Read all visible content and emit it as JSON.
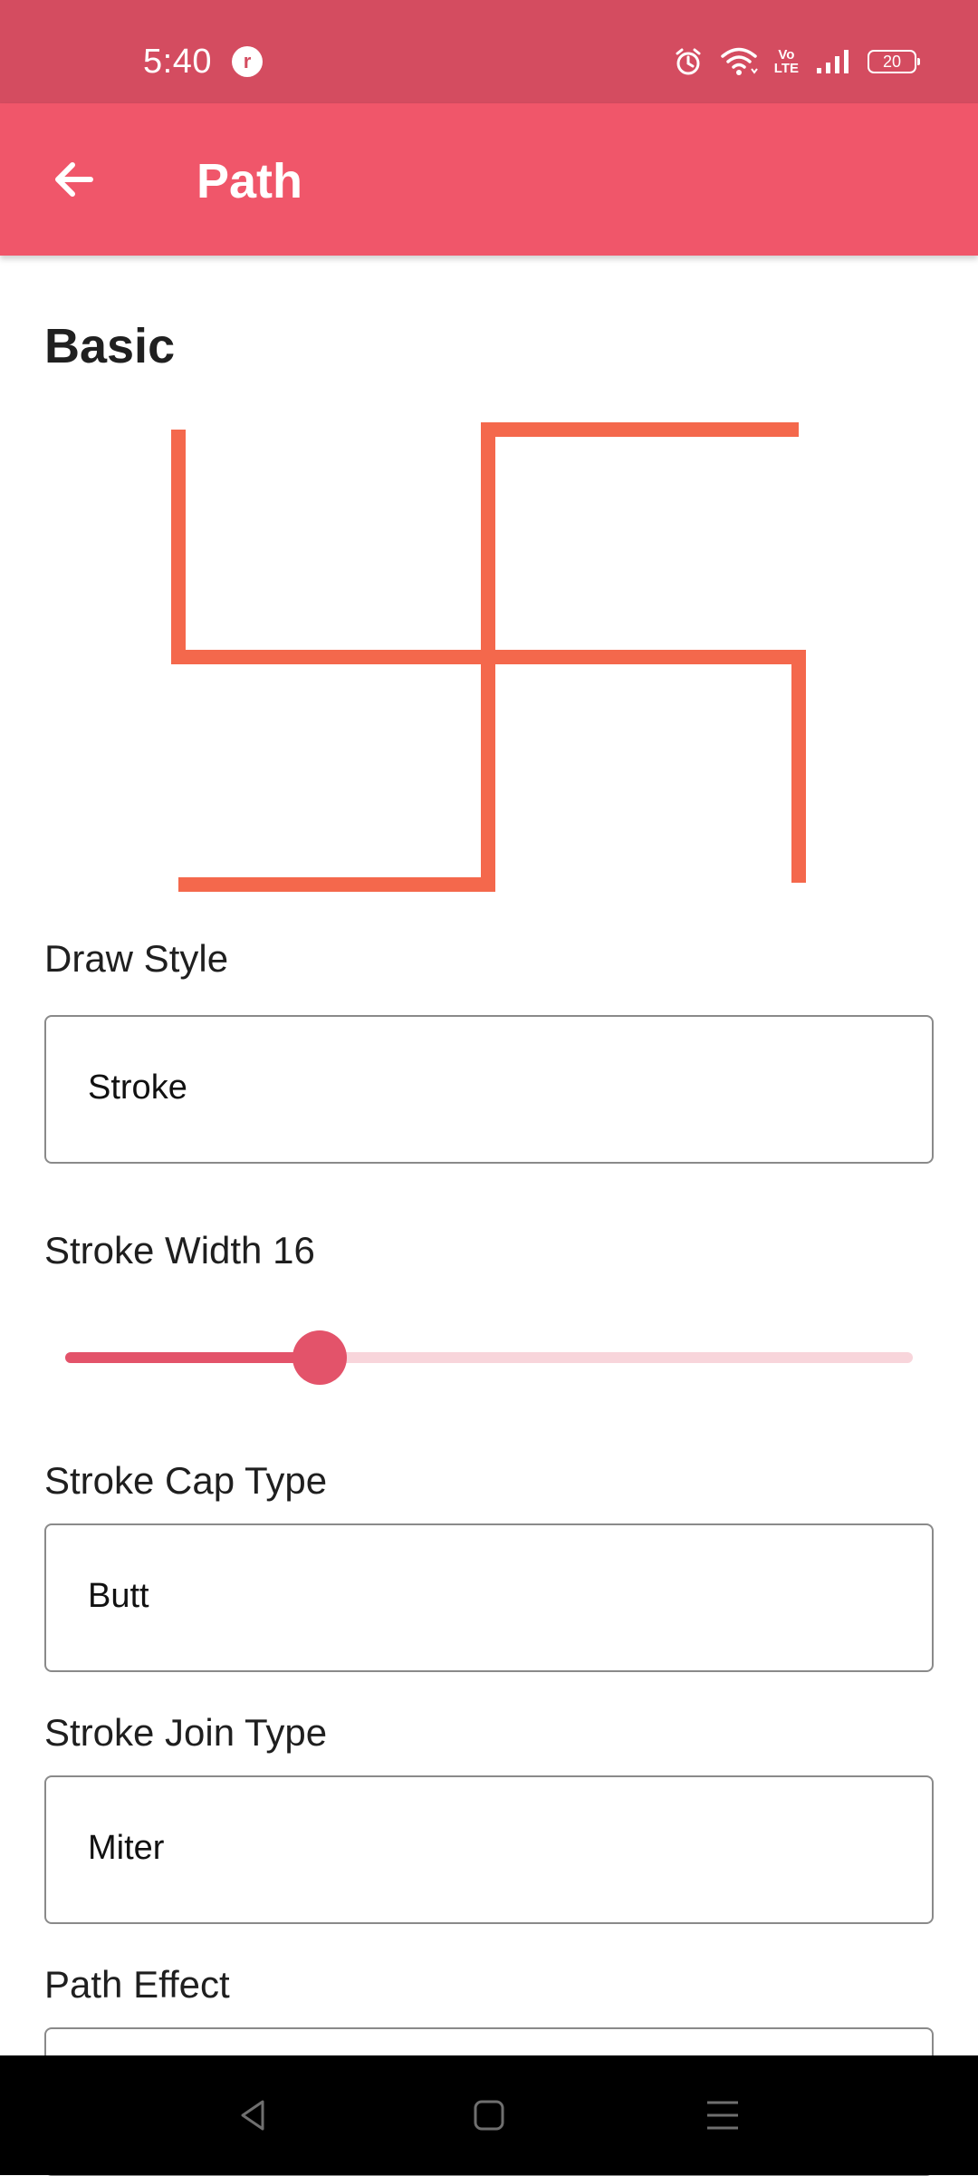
{
  "status_bar": {
    "time": "5:40",
    "app_badge": "r",
    "volte_line1": "Vo",
    "volte_line2": "LTE",
    "battery": "20",
    "icons": [
      "alarm-icon",
      "wifi-icon",
      "volte-icon",
      "signal-icon",
      "battery-icon"
    ]
  },
  "app_bar": {
    "title": "Path",
    "back_icon": "arrow-left-icon",
    "color": "#f0566a"
  },
  "section": {
    "title": "Basic"
  },
  "canvas": {
    "stroke_color": "#f4684c"
  },
  "fields": {
    "draw_style": {
      "label": "Draw Style",
      "value": "Stroke"
    },
    "stroke_width": {
      "label": "Stroke Width 16",
      "value": 16,
      "fraction": 0.3
    },
    "stroke_cap": {
      "label": "Stroke Cap Type",
      "value": "Butt"
    },
    "stroke_join": {
      "label": "Stroke Join Type",
      "value": "Miter"
    },
    "path_effect": {
      "label": "Path Effect",
      "value": ""
    }
  },
  "colors": {
    "status_bar": "#d44c60",
    "accent": "#e3536a",
    "track": "#f8d5db"
  },
  "nav_bar": {
    "icons": [
      "back-triangle-icon",
      "home-square-icon",
      "menu-lines-icon"
    ]
  }
}
